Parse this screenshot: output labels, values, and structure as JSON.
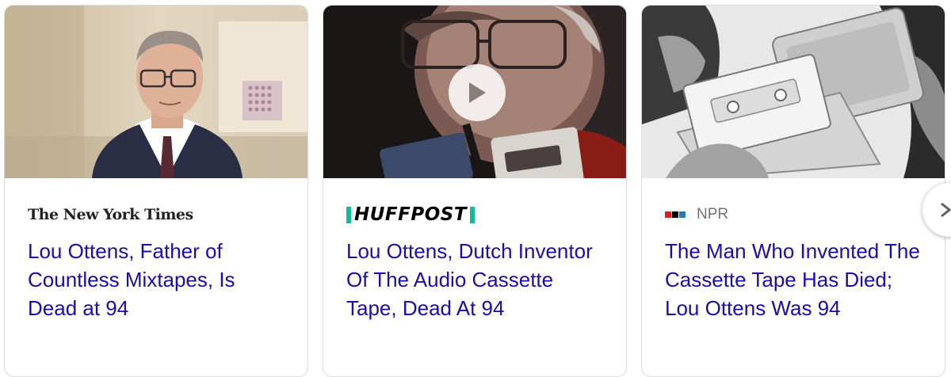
{
  "cards": [
    {
      "source": "The New York Times",
      "headline": "Lou Ottens, Father of Countless Mixtapes, Is Dead at 94",
      "has_video": false
    },
    {
      "source": "HUFFPOST",
      "headline": "Lou Ottens, Dutch Inventor Of The Audio Cassette Tape, Dead At 94",
      "has_video": true
    },
    {
      "source": "NPR",
      "headline": "The Man Who Invented The Cassette Tape Has Died; Lou Ottens Was 94",
      "has_video": false
    }
  ],
  "icons": {
    "play": "play-icon",
    "next": "chevron-right-icon"
  },
  "colors": {
    "headline_link": "#1a0dab",
    "huffpost_accent": "#0dbe98",
    "npr_red": "#d62021",
    "npr_black": "#000000",
    "npr_blue": "#237bbd"
  }
}
